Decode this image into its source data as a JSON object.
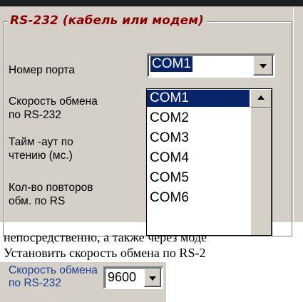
{
  "group": {
    "title": "RS-232 (кабель или модем)"
  },
  "fields": {
    "port_label": "Номер порта",
    "port_value": "COM1",
    "speed_label_l1": "Скорость обмена",
    "speed_label_l2": "по RS-232",
    "timeout_label_l1": "Тайм -аут по",
    "timeout_label_l2": "чтению (мс.)",
    "retries_label_l1": "Кол-во повторов",
    "retries_label_l2": "обм. по RS"
  },
  "port_options": [
    "COM1",
    "COM2",
    "COM3",
    "COM4",
    "COM5",
    "COM6"
  ],
  "selected_option": "COM1",
  "body_text": {
    "line1": "непосредственно, а также через моде",
    "line2": "Установить скорость обмена по RS-2"
  },
  "speed_crop": {
    "label_l1": "Скорость обмена",
    "label_l2": "по RS-232",
    "value": "9600"
  },
  "colors": {
    "panel_bg": "#d4d0c8",
    "selection": "#0a246a",
    "group_title": "#8b0000",
    "crop_label": "#1c3f94"
  },
  "icons": {
    "dropdown_arrow": "chevron-down-icon",
    "scroll_up": "scroll-up-arrow-icon"
  }
}
